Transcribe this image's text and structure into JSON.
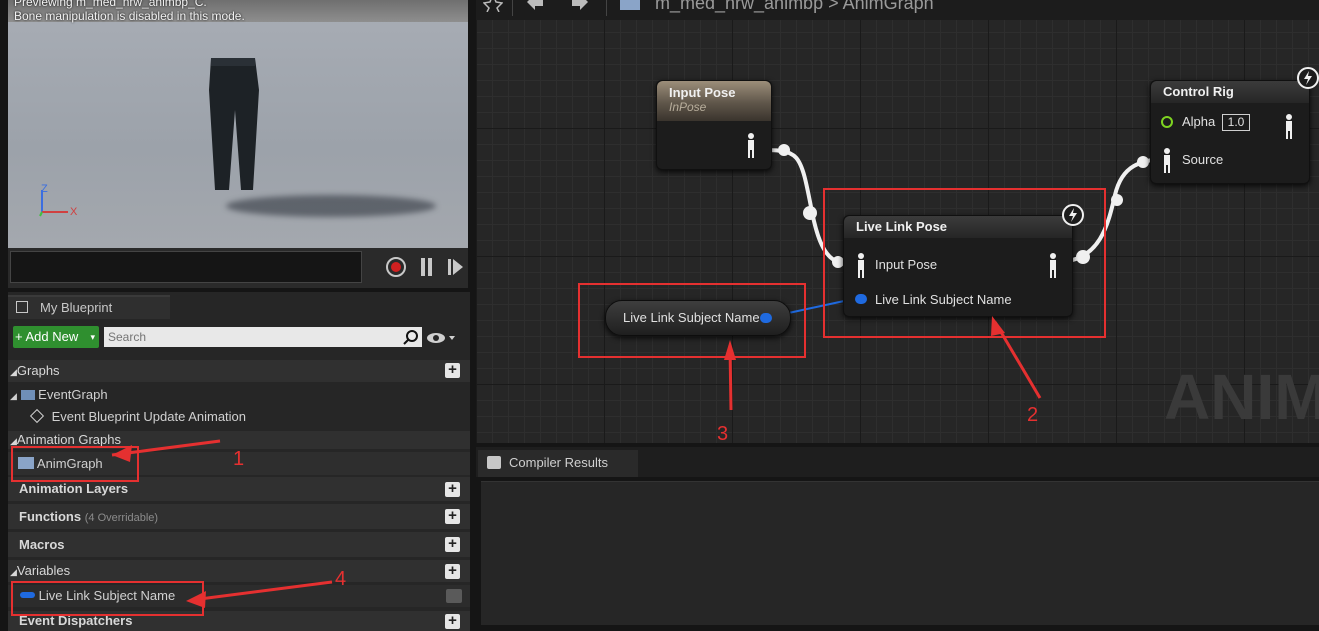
{
  "viewport": {
    "preview_text": "Previewing m_med_nrw_animbp_C.",
    "bone_text": "Bone manipulation is disabled in this mode.",
    "axis_z": "Z",
    "axis_x": "X"
  },
  "toolbar": {
    "breadcrumb_asset": "m_med_nrw_animbp",
    "breadcrumb_sep": ">",
    "breadcrumb_graph": "AnimGraph"
  },
  "my_blueprint": {
    "tab_label": "My Blueprint",
    "add_new_label": "+ Add New",
    "search_placeholder": "Search",
    "sections": {
      "graphs": "Graphs",
      "event_graph": "EventGraph",
      "event_update": "Event Blueprint Update Animation",
      "animation_graphs": "Animation Graphs",
      "anim_graph": "AnimGraph",
      "animation_layers": "Animation Layers",
      "functions": "Functions",
      "functions_note": "(4 Overridable)",
      "macros": "Macros",
      "variables": "Variables",
      "var_live_link": "Live Link Subject Name",
      "event_dispatchers": "Event Dispatchers"
    }
  },
  "graph": {
    "watermark": "ANIMA",
    "input_pose": {
      "title": "Input Pose",
      "subtitle": "InPose"
    },
    "control_rig": {
      "title": "Control Rig",
      "alpha_label": "Alpha",
      "alpha_value": "1.0",
      "source_label": "Source"
    },
    "live_link_pose": {
      "title": "Live Link Pose",
      "input_pose": "Input Pose",
      "subject_name": "Live Link Subject Name"
    },
    "variable_node": {
      "label": "Live Link Subject Name"
    }
  },
  "annotations": {
    "a1": "1",
    "a2": "2",
    "a3": "3",
    "a4": "4"
  },
  "compiler": {
    "tab_label": "Compiler Results"
  },
  "colors": {
    "annotation_red": "#e53030",
    "name_pin_blue": "#1f6ae0",
    "exec_white": "#ffffff",
    "add_new_green": "#2f8f2f"
  }
}
